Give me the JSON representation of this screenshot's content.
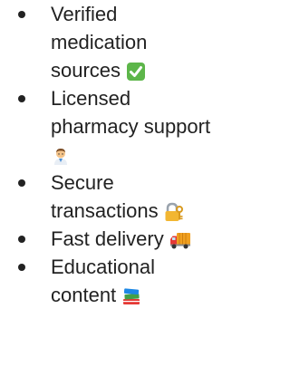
{
  "features": [
    {
      "text": "Verified medication sources",
      "icon": "check-mark-icon"
    },
    {
      "text": "Licensed pharmacy support",
      "icon": "health-worker-icon"
    },
    {
      "text": "Secure transactions",
      "icon": "lock-with-key-icon"
    },
    {
      "text": "Fast delivery",
      "icon": "delivery-truck-icon"
    },
    {
      "text": "Educational content",
      "icon": "books-icon"
    }
  ]
}
